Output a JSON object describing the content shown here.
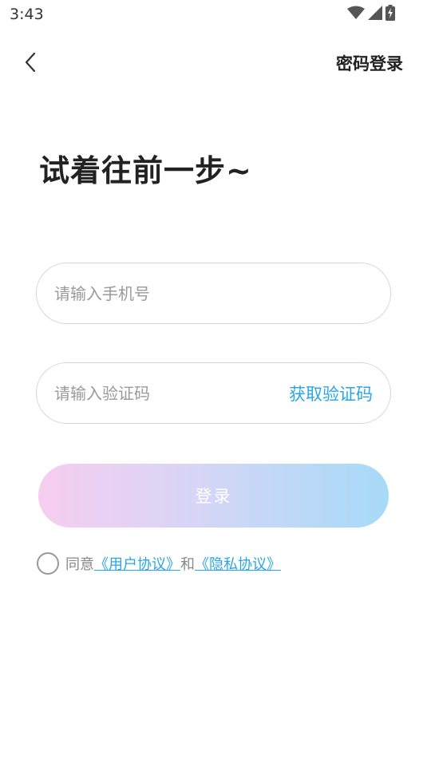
{
  "status_bar": {
    "time": "3:43"
  },
  "nav": {
    "right_action": "密码登录"
  },
  "headline": "试着往前一步~",
  "form": {
    "phone_placeholder": "请输入手机号",
    "code_placeholder": "请输入验证码",
    "get_code_label": "获取验证码",
    "login_label": "登录"
  },
  "agreement": {
    "prefix": "同意",
    "user_agreement": "《用户协议》",
    "and": "和",
    "privacy_policy": "《隐私协议》"
  },
  "colors": {
    "accent": "#29a6e8",
    "gradient_start": "#f6cdef",
    "gradient_end": "#a6daf8"
  }
}
